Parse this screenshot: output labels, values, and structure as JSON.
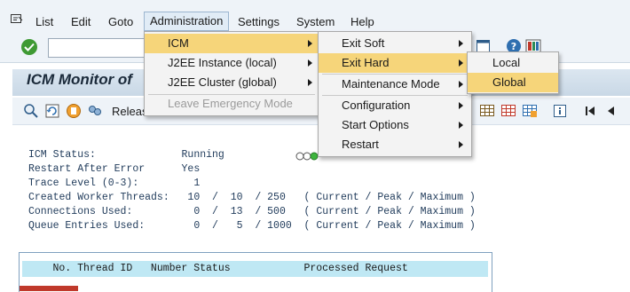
{
  "menubar": {
    "items": [
      "List",
      "Edit",
      "Goto",
      "Administration",
      "Settings",
      "System",
      "Help"
    ]
  },
  "title": "ICM Monitor of",
  "app_toolbar": {
    "release_label": "Releas"
  },
  "status": {
    "lines": [
      "ICM Status:              Running",
      "Restart After Error      Yes",
      "Trace Level (0-3):         1",
      "Created Worker Threads:   10  /  10  / 250   ( Current / Peak / Maximum )",
      "Connections Used:          0  /  13  / 500   ( Current / Peak / Maximum )",
      "Queue Entries Used:        0  /   5  / 1000  ( Current / Peak / Maximum )"
    ]
  },
  "table": {
    "header": "     No. Thread ID   Number Status            Processed Request"
  },
  "admin_menu": {
    "items": [
      {
        "label": "ICM",
        "submenu": true,
        "highlighted": true,
        "disabled": false
      },
      {
        "label": "J2EE Instance (local)",
        "submenu": true,
        "highlighted": false,
        "disabled": false
      },
      {
        "label": "J2EE Cluster (global)",
        "submenu": true,
        "highlighted": false,
        "disabled": false
      },
      {
        "label": "Leave Emergency Mode",
        "submenu": false,
        "highlighted": false,
        "disabled": true
      }
    ]
  },
  "icm_menu": {
    "items": [
      {
        "label": "Exit Soft",
        "submenu": true,
        "highlighted": false
      },
      {
        "label": "Exit Hard",
        "submenu": true,
        "highlighted": true
      },
      {
        "label": "Maintenance Mode",
        "submenu": true,
        "highlighted": false
      },
      {
        "label": "Configuration",
        "submenu": true,
        "highlighted": false
      },
      {
        "label": "Start Options",
        "submenu": true,
        "highlighted": false
      },
      {
        "label": "Restart",
        "submenu": true,
        "highlighted": false
      }
    ]
  },
  "exit_hard_menu": {
    "items": [
      {
        "label": "Local",
        "highlighted": false
      },
      {
        "label": "Global",
        "highlighted": true
      }
    ]
  },
  "colors": {
    "highlight": "#f6d57a",
    "menubar_bg": "#eef3f8",
    "status_text": "#1f3a5a",
    "table_header": "#bfe8f4"
  }
}
